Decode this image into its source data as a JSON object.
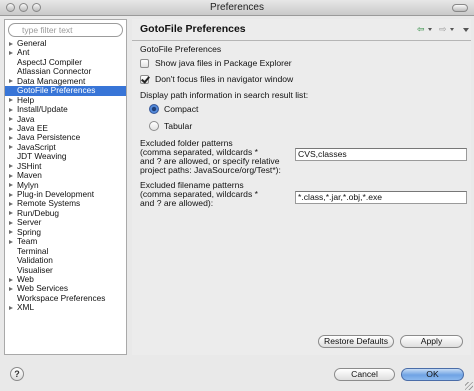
{
  "window": {
    "title": "Preferences"
  },
  "filter": {
    "placeholder": "type filter text"
  },
  "tree": {
    "items": [
      {
        "label": "General",
        "arrow": true
      },
      {
        "label": "Ant",
        "arrow": true
      },
      {
        "label": "AspectJ Compiler",
        "arrow": false
      },
      {
        "label": "Atlassian Connector",
        "arrow": false
      },
      {
        "label": "Data Management",
        "arrow": true
      },
      {
        "label": "GotoFile Preferences",
        "arrow": false,
        "selected": true
      },
      {
        "label": "Help",
        "arrow": true
      },
      {
        "label": "Install/Update",
        "arrow": true
      },
      {
        "label": "Java",
        "arrow": true
      },
      {
        "label": "Java EE",
        "arrow": true
      },
      {
        "label": "Java Persistence",
        "arrow": true
      },
      {
        "label": "JavaScript",
        "arrow": true
      },
      {
        "label": "JDT Weaving",
        "arrow": false
      },
      {
        "label": "JSHint",
        "arrow": true
      },
      {
        "label": "Maven",
        "arrow": true
      },
      {
        "label": "Mylyn",
        "arrow": true
      },
      {
        "label": "Plug-in Development",
        "arrow": true
      },
      {
        "label": "Remote Systems",
        "arrow": true
      },
      {
        "label": "Run/Debug",
        "arrow": true
      },
      {
        "label": "Server",
        "arrow": true
      },
      {
        "label": "Spring",
        "arrow": true
      },
      {
        "label": "Team",
        "arrow": true
      },
      {
        "label": "Terminal",
        "arrow": false
      },
      {
        "label": "Validation",
        "arrow": false
      },
      {
        "label": "Visualiser",
        "arrow": false
      },
      {
        "label": "Web",
        "arrow": true
      },
      {
        "label": "Web Services",
        "arrow": true
      },
      {
        "label": "Workspace Preferences",
        "arrow": false
      },
      {
        "label": "XML",
        "arrow": true
      }
    ]
  },
  "page": {
    "title": "GotoFile Preferences",
    "section_label": "GotoFile Preferences",
    "show_java_label": "Show java files in Package Explorer",
    "show_java_checked": false,
    "dont_focus_label": "Don't focus files in navigator window",
    "dont_focus_checked": true,
    "display_path_label": "Display path information in search result list:",
    "compact_label": "Compact",
    "compact_selected": true,
    "tabular_label": "Tabular",
    "tabular_selected": false,
    "excluded_folder_label_1": "Excluded folder patterns",
    "excluded_folder_label_2": "(comma separated, wildcards *",
    "excluded_folder_label_3": "and ? are allowed, or specify relative",
    "excluded_folder_label_4": " project paths: JavaSource/org/Test*):",
    "excluded_folder_value": "CVS,classes",
    "excluded_file_label_1": "Excluded filename patterns",
    "excluded_file_label_2": "(comma separated, wildcards *",
    "excluded_file_label_3": "and ? are allowed):",
    "excluded_file_value": "*.class,*.jar,*.obj,*.exe",
    "restore_defaults_label": "Restore Defaults",
    "apply_label": "Apply"
  },
  "footer": {
    "help_glyph": "?",
    "cancel_label": "Cancel",
    "ok_label": "OK"
  },
  "icons": {
    "back": "back-arrow-icon",
    "forward": "forward-arrow-icon",
    "help": "help-icon",
    "search": "search-icon"
  },
  "colors": {
    "selection": "#3875d7",
    "ok_button": "#6fa3e4",
    "back_arrow": "#2b8a3e"
  }
}
